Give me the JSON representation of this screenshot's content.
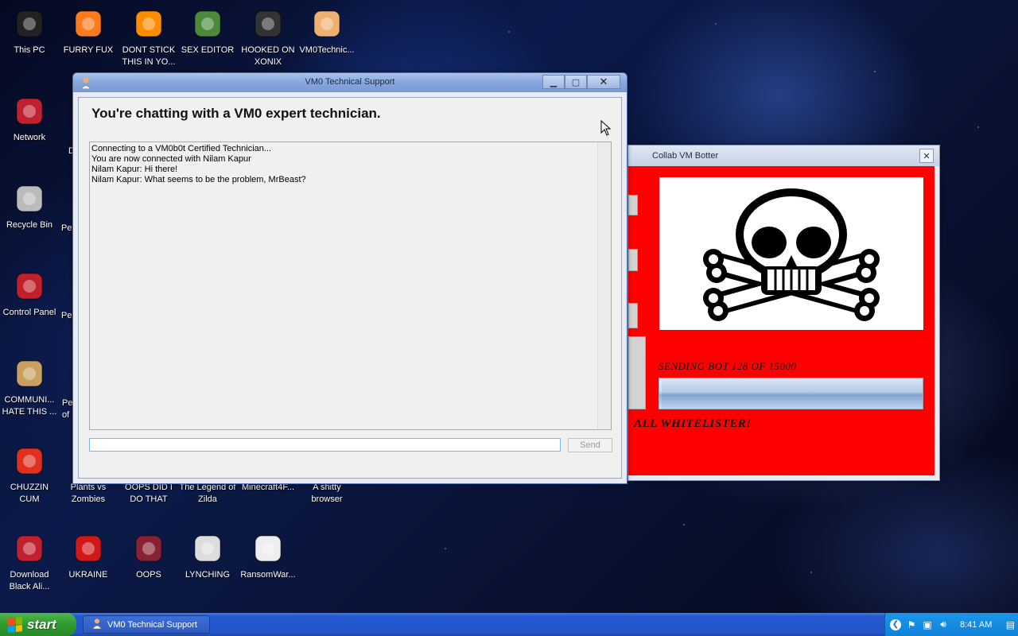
{
  "desktop": {
    "icons": [
      {
        "label": "This PC",
        "icon": "computer-icon"
      },
      {
        "label": "FURRY FUX",
        "icon": "firefox-icon"
      },
      {
        "label": "DONT STICK\nTHIS IN YO...",
        "icon": "vlc-cone-icon"
      },
      {
        "label": "SEX EDITOR",
        "icon": "hxd-editor-icon"
      },
      {
        "label": "HOOKED ON\nXONIX",
        "icon": "xonix-game-icon"
      },
      {
        "label": "VM0Technic...",
        "icon": "support-technician-icon"
      },
      {
        "label": "Network",
        "icon": "network-icon"
      },
      {
        "label": "Recycle Bin",
        "icon": "recycle-bin-icon"
      },
      {
        "label": "Control Panel",
        "icon": "control-panel-icon"
      },
      {
        "label": "COMMUNI...\nHATE THIS ...",
        "icon": "money-bag-icon"
      },
      {
        "label": "CHUZZIN\nCUM",
        "icon": "chuzzle-icon"
      },
      {
        "label": "Plants vs\nZombies",
        "icon": "plants-vs-zombies-icon"
      },
      {
        "label": "OOPS DID I\nDO THAT",
        "icon": "oops-did-i-icon"
      },
      {
        "label": "The Legend of\nZilda",
        "icon": "zilda-icon"
      },
      {
        "label": "Minecraft4F...",
        "icon": "minecraft-icon"
      },
      {
        "label": "A shitty\nbrowser",
        "icon": "browser-icon"
      },
      {
        "label": "Download\nBlack Ali...",
        "icon": "download-icon"
      },
      {
        "label": "UKRAINE",
        "icon": "radiation-icon"
      },
      {
        "label": "OOPS",
        "icon": "oops-icon"
      },
      {
        "label": "LYNCHING",
        "icon": "noose-icon"
      },
      {
        "label": "RansomWar...",
        "icon": "skull-icon"
      }
    ],
    "partial_labels": {
      "network_side": "D",
      "recycle_side": "Pe",
      "control_side": "Pe",
      "communi_side": "Pe\nof"
    }
  },
  "chat_window": {
    "title": "VM0 Technical Support",
    "heading": "You're chatting with a VM0 expert technician.",
    "messages": [
      "Connecting to a VM0b0t Certified Technician...",
      "You are now connected with Nilam Kapur",
      "Nilam Kapur: Hi there!",
      "Nilam Kapur: What seems to be the problem, MrBeast?"
    ],
    "input_value": "",
    "send_label": "Send"
  },
  "botter_window": {
    "title": "Collab VM Botter",
    "close_label": "✕",
    "status_text": "SENDING BOT 128 OF 15000",
    "progress_fraction": 0.0085,
    "whitelist_text": "ALL WHITELISTER!",
    "image_icon": "skull-crossbones-icon"
  },
  "taskbar": {
    "start_label": "start",
    "task_item_label": "VM0 Technical Support",
    "clock": "8:41 AM"
  },
  "colors": {
    "botter_background": "#ff0000",
    "taskbar": "#2458d0",
    "start_button": "#2f9b2f"
  }
}
